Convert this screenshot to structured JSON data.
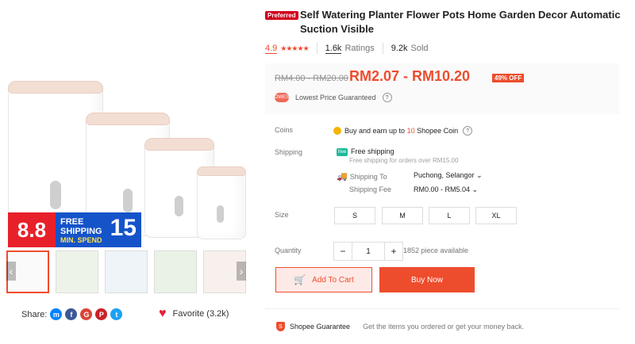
{
  "product": {
    "preferred_badge": "Preferred",
    "title": "Self Watering Planter Flower Pots Home Garden Decor Automatic Suction Visible",
    "rating": "4.9",
    "stars": "★★★★★",
    "ratings_count": "1.6k",
    "ratings_label": "Ratings",
    "sold": "9.2k",
    "sold_label": "Sold"
  },
  "price": {
    "original": "RM4.00 - RM20.00",
    "current": "RM2.07 - RM10.20",
    "discount": "49% OFF",
    "lowest_price_badge": "LOWEST",
    "lowest_price_text": "Lowest Price Guaranteed"
  },
  "coins": {
    "label": "Coins",
    "text_before": "Buy and earn up to",
    "amount": "10",
    "text_after": "Shopee Coin"
  },
  "shipping": {
    "label": "Shipping",
    "free_icon": "free",
    "free_text": "Free shipping",
    "free_sub": "Free shipping for orders over RM15.00",
    "to_label": "Shipping To",
    "to_value": "Puchong, Selangor",
    "fee_label": "Shipping Fee",
    "fee_value": "RM0.00 - RM5.04"
  },
  "size": {
    "label": "Size",
    "options": [
      "S",
      "M",
      "L",
      "XL"
    ]
  },
  "quantity": {
    "label": "Quantity",
    "minus": "−",
    "value": "1",
    "plus": "+",
    "available": "1852 piece available"
  },
  "actions": {
    "add_to_cart": "Add To Cart",
    "buy_now": "Buy Now"
  },
  "guarantee": {
    "title": "Shopee Guarantee",
    "text": "Get the items you ordered or get your money back."
  },
  "promo": {
    "date": "8.8",
    "free": "FREE",
    "shipping": "SHIPPING",
    "min_spend": "MIN. SPEND",
    "amount": "15"
  },
  "share": {
    "label": "Share:",
    "favorite": "Favorite (3.2k)"
  },
  "thumb_arrows": {
    "left": "‹",
    "right": "›"
  },
  "colors": {
    "accent": "#ee4d2d",
    "promo_red": "#e8202a",
    "promo_blue": "#1553c9"
  }
}
